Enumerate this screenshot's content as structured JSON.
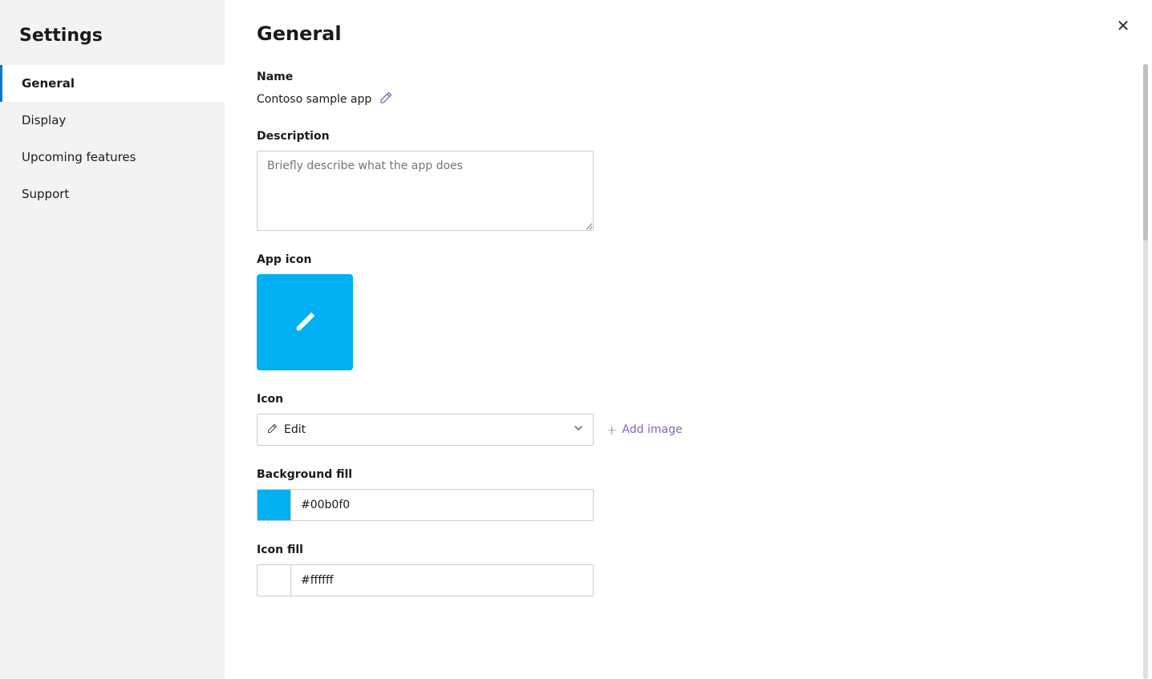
{
  "sidebar": {
    "title": "Settings",
    "items": [
      {
        "id": "general",
        "label": "General",
        "active": true
      },
      {
        "id": "display",
        "label": "Display",
        "active": false
      },
      {
        "id": "upcoming-features",
        "label": "Upcoming features",
        "active": false
      },
      {
        "id": "support",
        "label": "Support",
        "active": false
      }
    ]
  },
  "main": {
    "title": "General",
    "name_section": {
      "label": "Name",
      "value": "Contoso sample app",
      "edit_tooltip": "Edit"
    },
    "description_section": {
      "label": "Description",
      "placeholder": "Briefly describe what the app does"
    },
    "app_icon_section": {
      "label": "App icon"
    },
    "icon_section": {
      "label": "Icon",
      "dropdown_value": "Edit",
      "add_image_label": "Add image"
    },
    "background_fill_section": {
      "label": "Background fill",
      "color_value": "#00b0f0"
    },
    "icon_fill_section": {
      "label": "Icon fill",
      "color_value": "#ffffff"
    }
  },
  "close_button_label": "✕"
}
